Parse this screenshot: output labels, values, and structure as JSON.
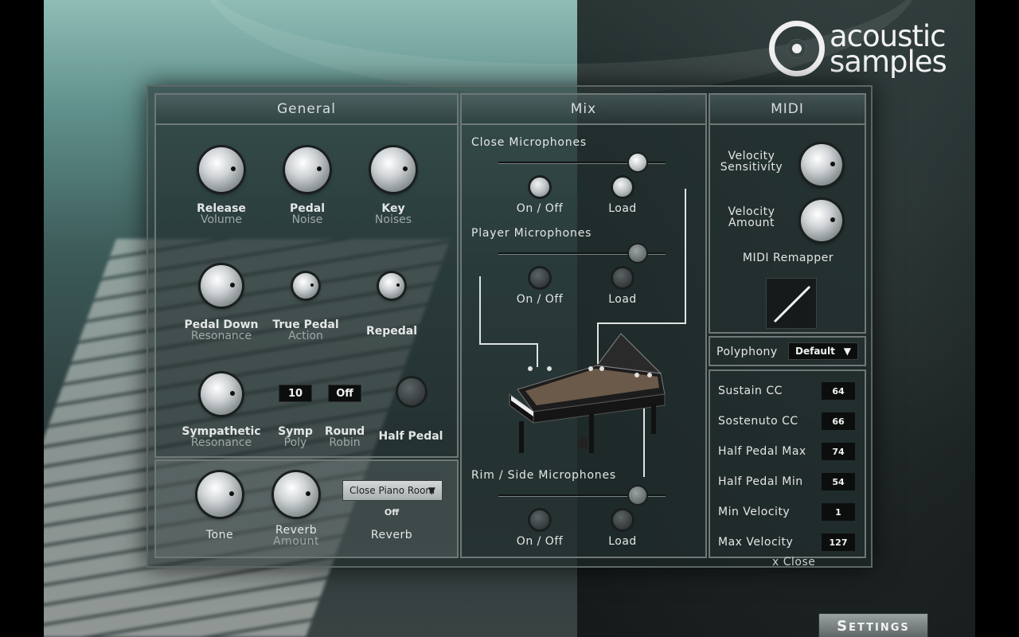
{
  "logo": {
    "line1": "acoustic",
    "line2": "samples"
  },
  "general": {
    "header": "General",
    "knobs": {
      "release_volume": {
        "label": "Release",
        "sub": "Volume"
      },
      "pedal_noise": {
        "label": "Pedal",
        "sub": "Noise"
      },
      "key_noises": {
        "label": "Key",
        "sub": "Noises"
      },
      "pedal_down_resonance": {
        "label": "Pedal Down",
        "sub": "Resonance"
      },
      "true_pedal_action": {
        "label": "True Pedal",
        "sub": "Action"
      },
      "repedal": {
        "label": "Repedal"
      },
      "sympathetic_resonance": {
        "label": "Sympathetic",
        "sub": "Resonance"
      },
      "half_pedal": {
        "label": "Half Pedal"
      }
    },
    "symp_poly": {
      "label": "Symp",
      "sub": "Poly",
      "value": "10"
    },
    "round_robin": {
      "label": "Round",
      "sub": "Robin",
      "value": "Off"
    },
    "tone": {
      "label": "Tone"
    },
    "reverb_amount": {
      "label": "Reverb",
      "sub": "Amount"
    },
    "reverb": {
      "preset": "Close Piano Room",
      "state": "Off",
      "label": "Reverb"
    }
  },
  "mix": {
    "header": "Mix",
    "close_mics": {
      "title": "Close Microphones",
      "on_off": "On / Off",
      "load": "Load"
    },
    "player_mics": {
      "title": "Player Microphones",
      "on_off": "On / Off",
      "load": "Load"
    },
    "rim_mics": {
      "title": "Rim / Side Microphones",
      "on_off": "On / Off",
      "load": "Load"
    }
  },
  "midi": {
    "header": "MIDI",
    "velocity_sensitivity": {
      "label": "Velocity",
      "sub": "Sensitivity"
    },
    "velocity_amount": {
      "label": "Velocity",
      "sub": "Amount"
    },
    "remapper_label": "MIDI Remapper",
    "polyphony": {
      "label": "Polyphony",
      "value": "Default"
    },
    "cc": [
      {
        "name": "Sustain CC",
        "value": "64"
      },
      {
        "name": "Sostenuto CC",
        "value": "66"
      },
      {
        "name": "Half Pedal Max",
        "value": "74"
      },
      {
        "name": "Half Pedal Min",
        "value": "54"
      },
      {
        "name": "Min Velocity",
        "value": "1"
      },
      {
        "name": "Max Velocity",
        "value": "127"
      }
    ],
    "close": "x Close"
  },
  "settings_button": "Settings"
}
